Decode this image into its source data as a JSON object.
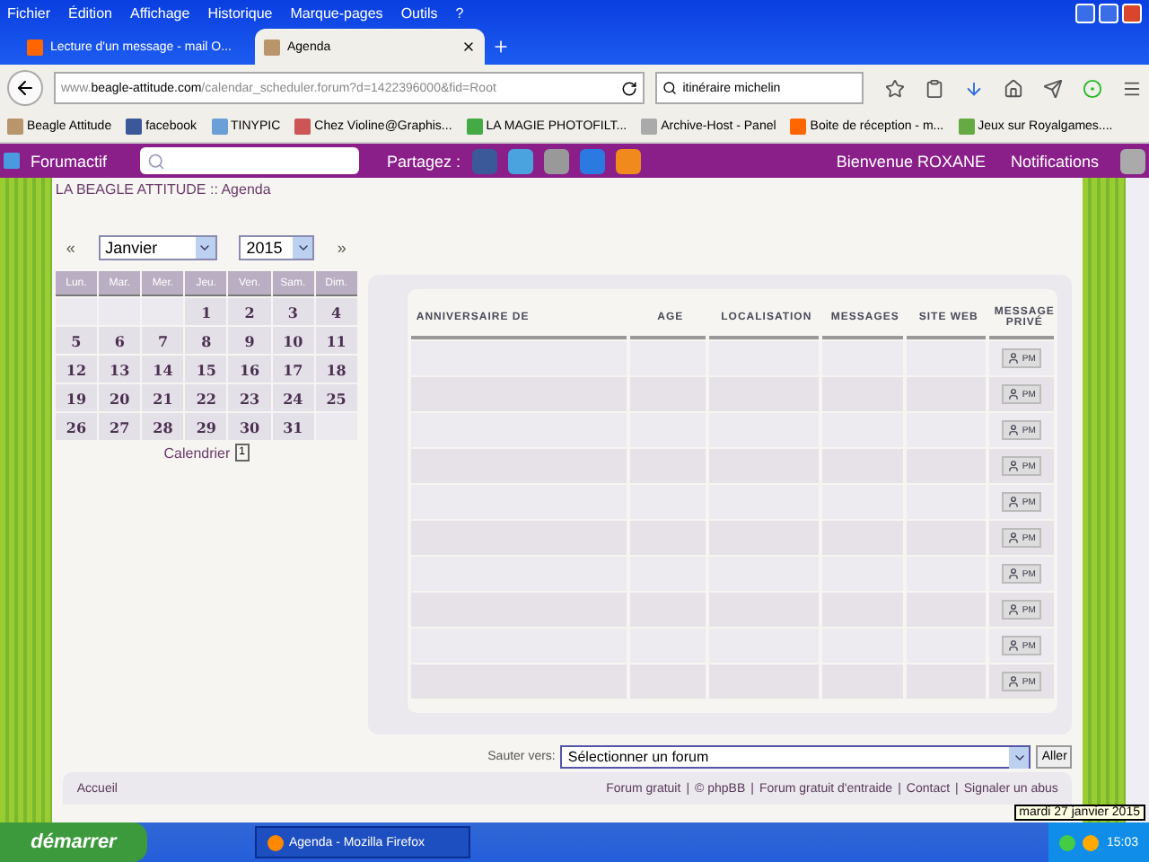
{
  "menu_bar": [
    "Fichier",
    "Édition",
    "Affichage",
    "Historique",
    "Marque-pages",
    "Outils",
    "?"
  ],
  "tabs": [
    {
      "label": "Lecture d'un message - mail O...",
      "selected": false
    },
    {
      "label": "Agenda",
      "selected": true
    }
  ],
  "address": {
    "domain_prefix": "www.",
    "domain": "beagle-attitude.com",
    "path": "/calendar_scheduler.forum?d=1422396000&fid=Root"
  },
  "search": {
    "value": "itinéraire michelin"
  },
  "bookmarks": [
    "Beagle Attitude",
    "facebook",
    "TINYPIC",
    "Chez Violine@Graphis...",
    "LA MAGIE PHOTOFILT...",
    "Archive-Host - Panel",
    "Boite de réception - m...",
    "Jeux sur Royalgames...."
  ],
  "forum_bar": {
    "brand": "Forumactif",
    "share_label": "Partagez :",
    "welcome": "Bienvenue ROXANE",
    "notifications": "Notifications"
  },
  "breadcrumb": "LA BEAGLE ATTITUDE :: Agenda",
  "calendar": {
    "prev": "«",
    "next": "»",
    "month": "Janvier",
    "year": "2015",
    "day_headers": [
      "Lun.",
      "Mar.",
      "Mer.",
      "Jeu.",
      "Ven.",
      "Sam.",
      "Dim."
    ],
    "weeks": [
      [
        "1",
        "2",
        "3",
        "4"
      ],
      [
        "5",
        "6",
        "7",
        "8",
        "9",
        "10",
        "11"
      ],
      [
        "12",
        "13",
        "14",
        "15",
        "16",
        "17",
        "18"
      ],
      [
        "19",
        "20",
        "21",
        "22",
        "23",
        "24",
        "25"
      ],
      [
        "26",
        "27",
        "28",
        "29",
        "30",
        "31"
      ]
    ],
    "footer": "Calendrier",
    "footer_icon_text": "1"
  },
  "table": {
    "columns": [
      "ANNIVERSAIRE DE",
      "AGE",
      "LOCALISATION",
      "MESSAGES",
      "SITE WEB",
      "MESSAGE PRIVÉ"
    ],
    "rows": [
      {
        "pm": "PM"
      },
      {
        "pm": "PM"
      },
      {
        "pm": "PM"
      },
      {
        "pm": "PM"
      },
      {
        "pm": "PM"
      },
      {
        "pm": "PM"
      },
      {
        "pm": "PM"
      },
      {
        "pm": "PM"
      },
      {
        "pm": "PM"
      },
      {
        "pm": "PM"
      }
    ]
  },
  "jump": {
    "label": "Sauter vers:",
    "value": "Sélectionner un forum",
    "button": "Aller"
  },
  "footer": {
    "home": "Accueil",
    "separator": "|",
    "links": [
      "Forum gratuit",
      "© phpBB",
      "Forum gratuit d'entraide",
      "Contact",
      "Signaler un abus"
    ]
  },
  "taskbar": {
    "start": "démarrer",
    "window": "Agenda - Mozilla Firefox",
    "clock": "15:03",
    "tooltip": "mardi 27 janvier 2015"
  }
}
